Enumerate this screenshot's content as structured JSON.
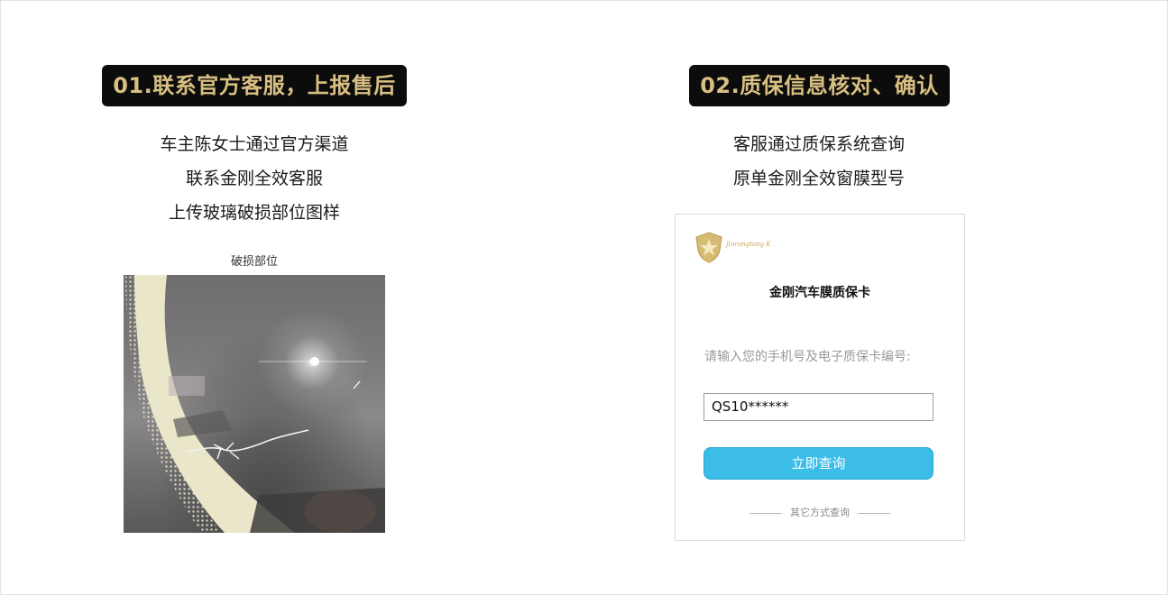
{
  "step1": {
    "title": "01.联系官方客服，上报售后",
    "lines": [
      "车主陈女士通过官方渠道",
      "联系金刚全效客服",
      "上传玻璃破损部位图样"
    ],
    "caption": "破损部位"
  },
  "step2": {
    "title": "02.质保信息核对、确认",
    "lines": [
      "客服通过质保系统查询",
      "原单金刚全效窗膜型号"
    ]
  },
  "card": {
    "logo_text": "Jinrongtong K",
    "title": "金刚汽车膜质保卡",
    "prompt": "请输入您的手机号及电子质保卡编号:",
    "input_value": "QS10******",
    "query_button": "立即查询",
    "other_methods": "其它方式查询"
  },
  "colors": {
    "badge_bg": "#0c0c0c",
    "badge_text": "#d8bf82",
    "button": "#3bbde8"
  },
  "icons": [
    "shield-logo-icon"
  ]
}
